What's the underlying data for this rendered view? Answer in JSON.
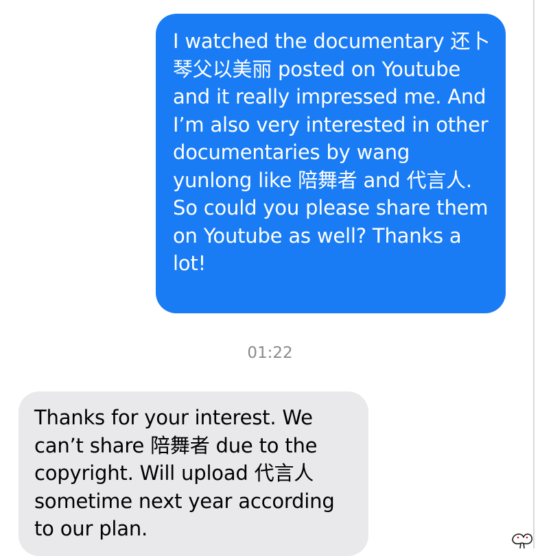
{
  "conversation": {
    "outgoing_message": "I watched the documentary 还卜琴父以美丽 posted on Youtube and it really impressed me. And I’m also very interested in other documentaries by wang yunlong like 陪舞者 and 代言人. So could you please share them on Youtube as well? Thanks a lot!",
    "timestamp": "01:22",
    "incoming_message": "Thanks for your interest. We can’t share 陪舞者 due to the copyright. Will upload 代言人 sometime next year according to our plan."
  },
  "colors": {
    "outgoing_bubble": "#1a7cf5",
    "incoming_bubble": "#e9e9eb",
    "timestamp_text": "#8a8a8e"
  },
  "icons": {
    "corner_mark": "small-logo-icon"
  }
}
